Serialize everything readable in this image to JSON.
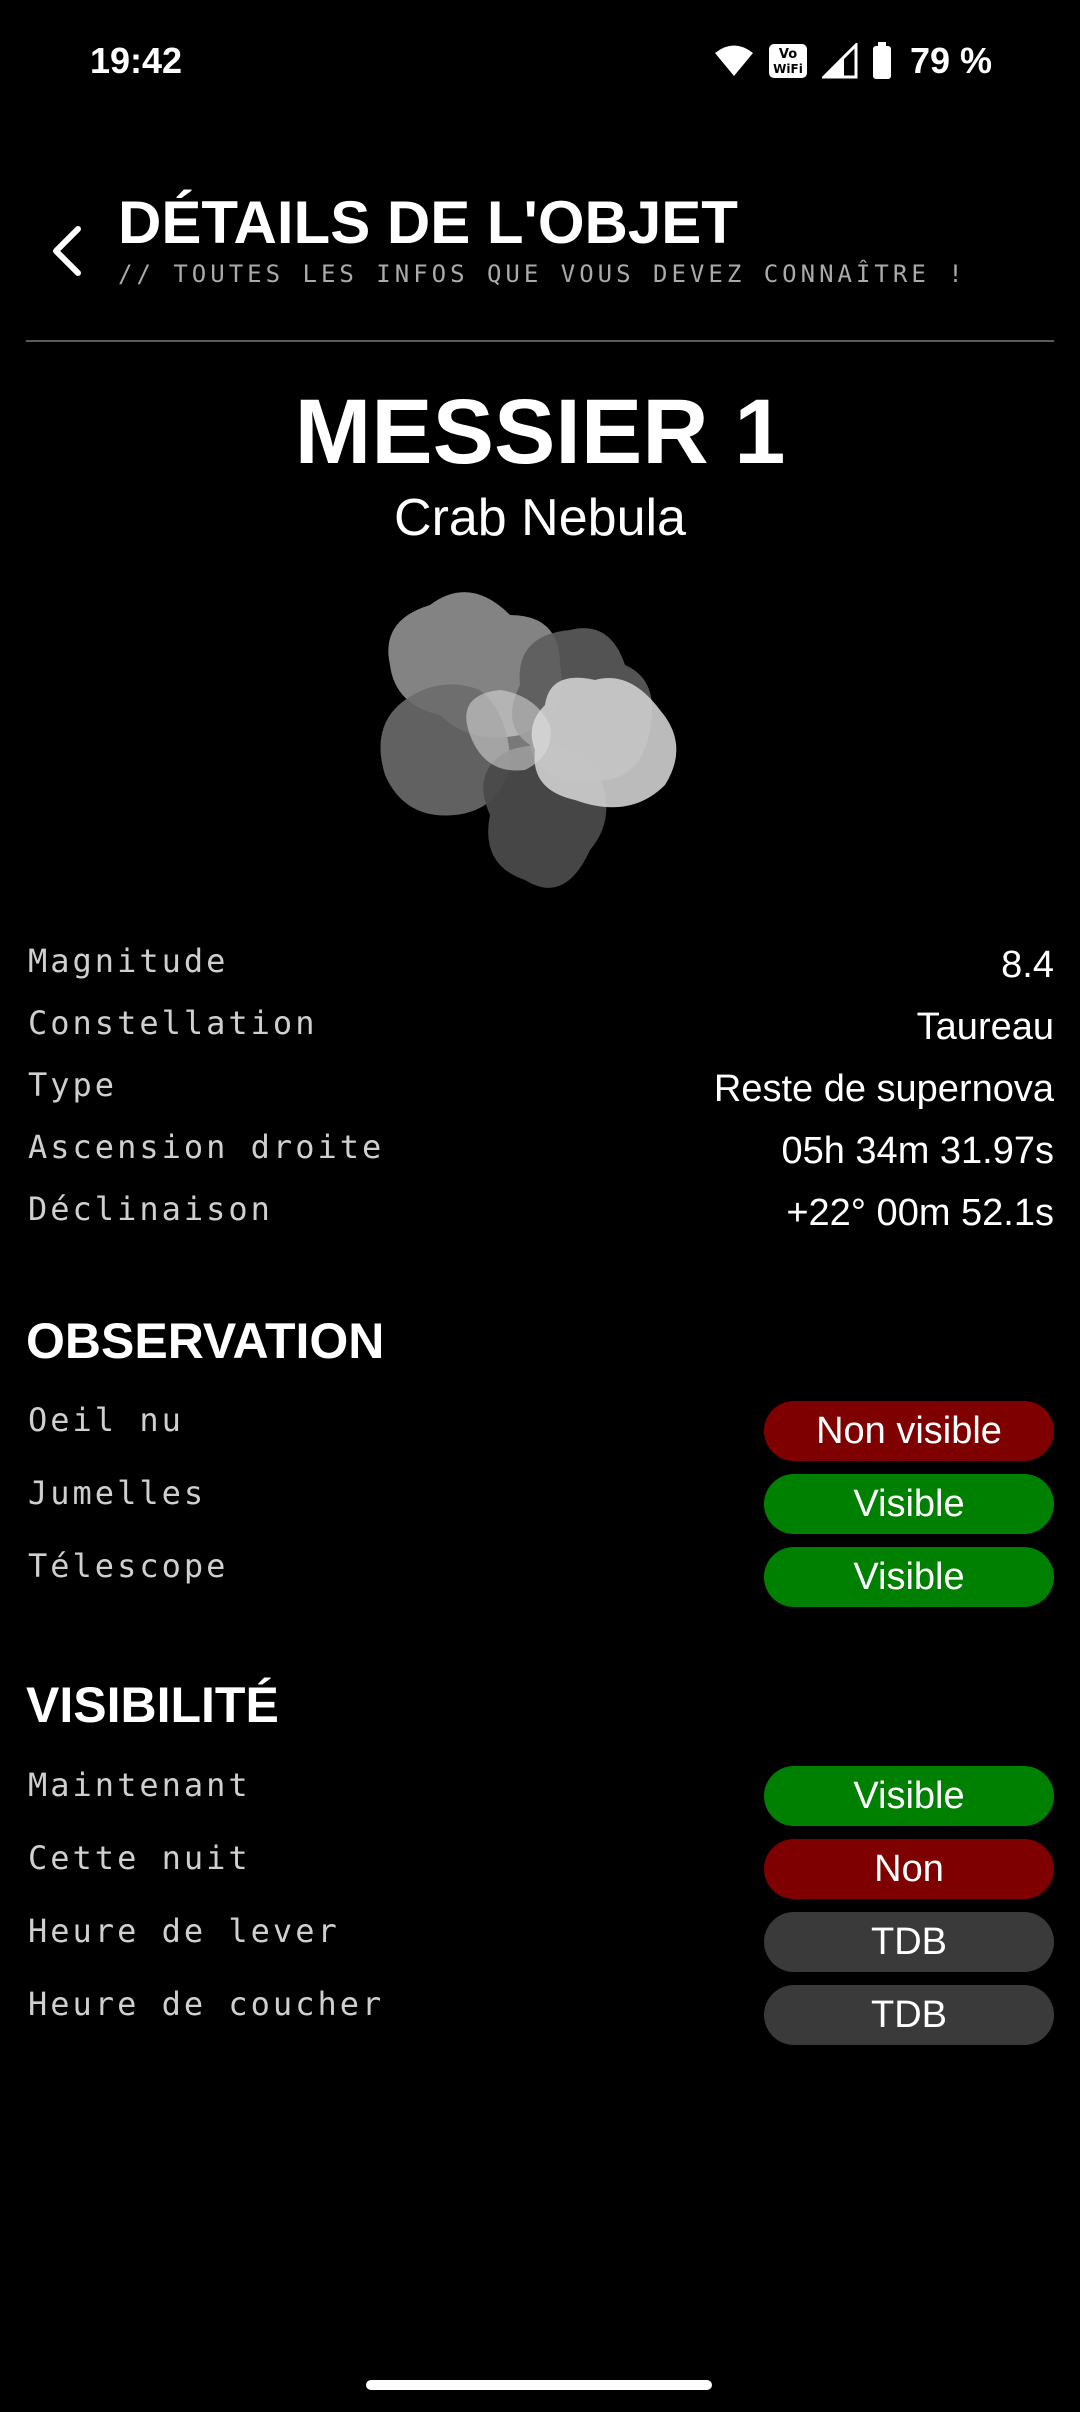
{
  "status_bar": {
    "time": "19:42",
    "battery": "79 %",
    "icons": [
      "wifi-icon",
      "vowifi-icon",
      "cellular-signal-icon",
      "battery-icon"
    ]
  },
  "header": {
    "back_icon": "chevron-left-icon",
    "title": "DÉTAILS DE L'OBJET",
    "subtitle": "// TOUTES LES INFOS QUE VOUS DEVEZ CONNAÎTRE !"
  },
  "object": {
    "name": "MESSIER 1",
    "alias": "Crab Nebula",
    "image_icon": "nebula-icon"
  },
  "details": [
    {
      "label": "Magnitude",
      "value": "8.4"
    },
    {
      "label": "Constellation",
      "value": "Taureau"
    },
    {
      "label": "Type",
      "value": "Reste de supernova"
    },
    {
      "label": "Ascension droite",
      "value": "05h 34m 31.97s"
    },
    {
      "label": "Déclinaison",
      "value": "+22° 00m 52.1s"
    }
  ],
  "observation": {
    "title": "OBSERVATION",
    "rows": [
      {
        "label": "Oeil nu",
        "status": "Non visible",
        "color": "#7f0000"
      },
      {
        "label": "Jumelles",
        "status": "Visible",
        "color": "#008000"
      },
      {
        "label": "Télescope",
        "status": "Visible",
        "color": "#008000"
      }
    ]
  },
  "visibility": {
    "title": "VISIBILITÉ",
    "rows": [
      {
        "label": "Maintenant",
        "status": "Visible",
        "color": "#008000"
      },
      {
        "label": "Cette nuit",
        "status": "Non",
        "color": "#7f0000"
      },
      {
        "label": "Heure de lever",
        "status": "TDB",
        "color": "#3a3a3a"
      },
      {
        "label": "Heure de coucher",
        "status": "TDB",
        "color": "#3a3a3a"
      }
    ]
  }
}
